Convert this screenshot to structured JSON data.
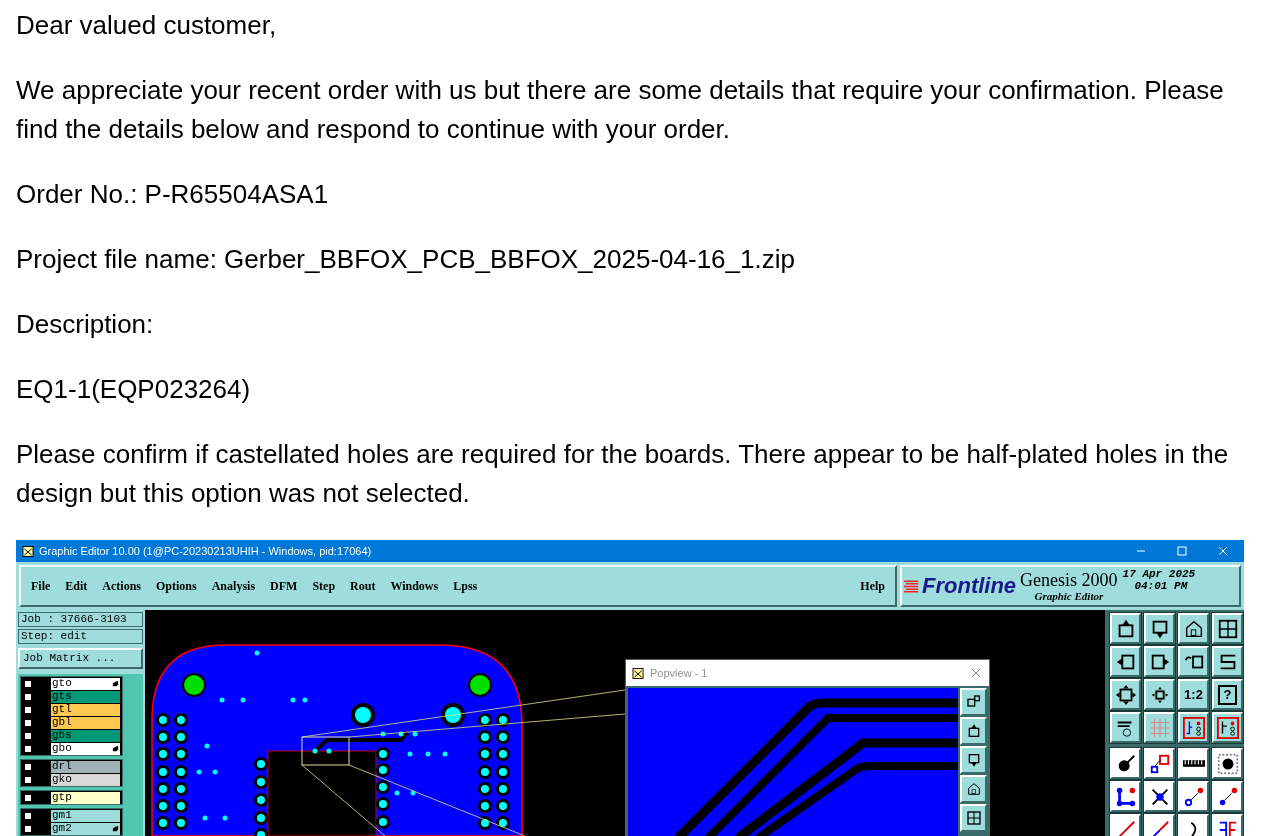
{
  "email": {
    "paragraphs": [
      "Dear valued customer,",
      "We appreciate your recent order with us but there are some details that require your confirmation. Please find the details below and respond to continue with your order.",
      "Order No.: P-R65504ASA1",
      "Project file name: Gerber_BBFOX_PCB_BBFOX_2025-04-16_1.zip",
      "Description:",
      "EQ1-1(EQP023264)",
      "Please confirm if castellated holes are required for the boards. There appear to be half-plated holes in the design but this option was not selected."
    ]
  },
  "screenshot": {
    "window": {
      "title": "Graphic Editor 10.00 (1@PC-20230213UHIH - Windows, pid:17064)"
    },
    "menu": [
      "File",
      "Edit",
      "Actions",
      "Options",
      "Analysis",
      "DFM",
      "Step",
      "Rout",
      "Windows",
      "Lpss"
    ],
    "help": "Help",
    "brand": {
      "logo": "Frontline",
      "product": "Genesis 2000",
      "subtitle": "Graphic Editor",
      "date": "17 Apr 2025",
      "time": "04:01 PM"
    },
    "job": "Job : 37666-3103",
    "step": "Step: edit",
    "job_matrix_button": "Job Matrix ...",
    "layer_groups": [
      [
        {
          "name": "gto",
          "color": "#ffffff",
          "checked": false,
          "hand": true
        },
        {
          "name": "gts",
          "color": "#009977",
          "checked": false,
          "hand": false
        },
        {
          "name": "gtl",
          "color": "#ffc850",
          "checked": false,
          "hand": false
        },
        {
          "name": "gbl",
          "color": "#ffc850",
          "checked": false,
          "hand": false
        },
        {
          "name": "gbs",
          "color": "#009977",
          "checked": false,
          "hand": false
        },
        {
          "name": "gbo",
          "color": "#ffffff",
          "checked": false,
          "hand": true
        }
      ],
      [
        {
          "name": "drl",
          "color": "#a0b4b8",
          "checked": false,
          "hand": false
        },
        {
          "name": "gko",
          "color": "#d8d8d8",
          "checked": false,
          "hand": false
        }
      ],
      [
        {
          "name": "gtp",
          "color": "#ffffc8",
          "checked": false,
          "hand": false
        }
      ],
      [
        {
          "name": "gm1",
          "color": "#9fdcdc",
          "checked": false,
          "hand": false
        },
        {
          "name": "gm2",
          "color": "#9fdcdc",
          "checked": false,
          "hand": true
        }
      ]
    ],
    "popview": {
      "title": "Popview - 1"
    },
    "tools": {
      "zoom_ratio": "1:2",
      "help": "?"
    }
  }
}
